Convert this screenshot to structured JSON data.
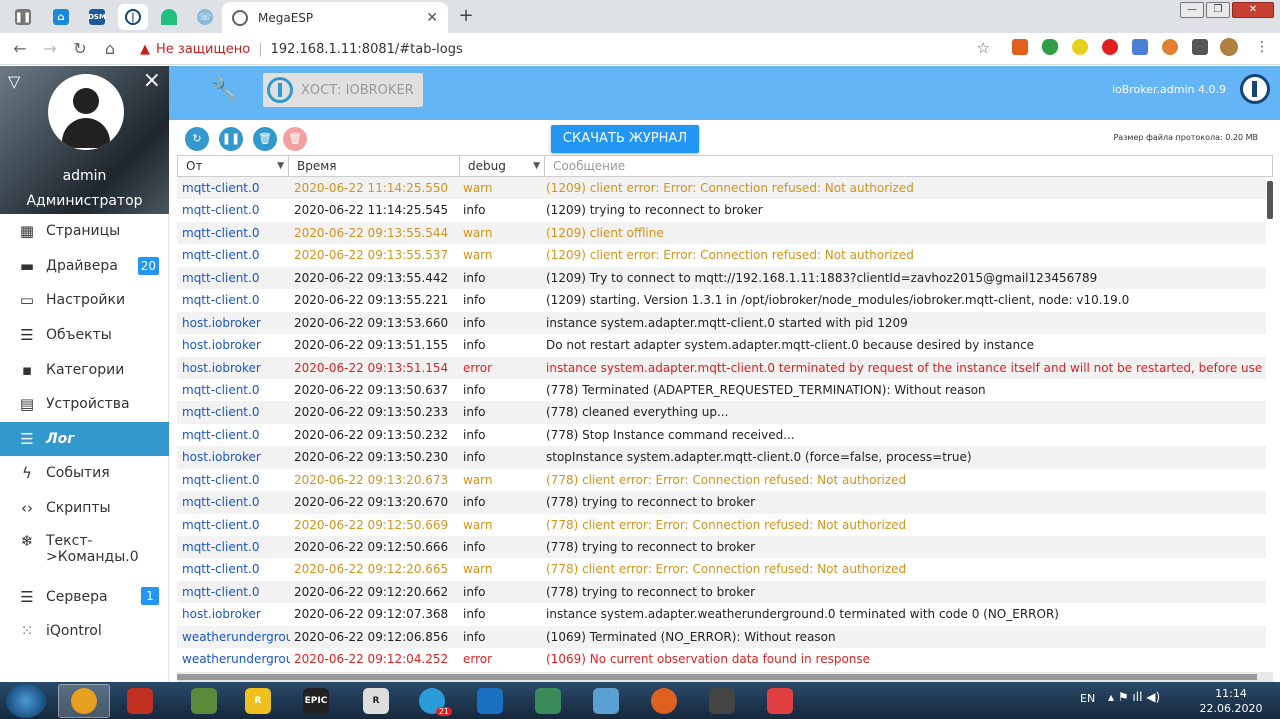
{
  "browser": {
    "tab_title": "MegaESP",
    "tab_close": "✕",
    "new_tab": "+",
    "not_secure": "Не защищено",
    "url": "192.168.1.11:8081/#tab-logs"
  },
  "sidebar": {
    "username": "admin",
    "role": "Администратор",
    "items": [
      {
        "label": "Страницы",
        "icon": "grid-icon"
      },
      {
        "label": "Драйвера",
        "icon": "store-icon",
        "badge": "20"
      },
      {
        "label": "Настройки",
        "icon": "settings-icon"
      },
      {
        "label": "Объекты",
        "icon": "list-icon"
      },
      {
        "label": "Категории",
        "icon": "categories-icon"
      },
      {
        "label": "Устройства",
        "icon": "devices-icon"
      },
      {
        "label": "Лог",
        "icon": "menu-icon",
        "active": true
      },
      {
        "label": "События",
        "icon": "bolt-icon"
      },
      {
        "label": "Скрипты",
        "icon": "code-icon"
      },
      {
        "label": "Текст-",
        "label2": ">Команды.0",
        "icon": "snowflake-icon"
      },
      {
        "label": "Сервера",
        "icon": "servers-icon",
        "badge": "1"
      },
      {
        "label": "iQontrol",
        "icon": "dots-icon"
      }
    ]
  },
  "header": {
    "host": "ХОСТ: IOBROKER",
    "version": "ioBroker.admin 4.0.9"
  },
  "log": {
    "download_label": "СКАЧАТЬ ЖУРНАЛ",
    "file_size": "Размер файла протокола: 0.20 MB",
    "columns": {
      "from": "От",
      "time": "Время",
      "severity": "debug",
      "message": "Сообщение"
    },
    "rows": [
      {
        "from": "mqtt-client.0",
        "time": "2020-06-22 11:14:25.550",
        "severity": "warn",
        "message": "(1209) client error: Error: Connection refused: Not authorized"
      },
      {
        "from": "mqtt-client.0",
        "time": "2020-06-22 11:14:25.545",
        "severity": "info",
        "message": "(1209) trying to reconnect to broker"
      },
      {
        "from": "mqtt-client.0",
        "time": "2020-06-22 09:13:55.544",
        "severity": "warn",
        "message": "(1209) client offline"
      },
      {
        "from": "mqtt-client.0",
        "time": "2020-06-22 09:13:55.537",
        "severity": "warn",
        "message": "(1209) client error: Error: Connection refused: Not authorized"
      },
      {
        "from": "mqtt-client.0",
        "time": "2020-06-22 09:13:55.442",
        "severity": "info",
        "message": "(1209) Try to connect to mqtt://192.168.1.11:1883?clientId=zavhoz2015@gmail123456789"
      },
      {
        "from": "mqtt-client.0",
        "time": "2020-06-22 09:13:55.221",
        "severity": "info",
        "message": "(1209) starting. Version 1.3.1 in /opt/iobroker/node_modules/iobroker.mqtt-client, node: v10.19.0"
      },
      {
        "from": "host.iobroker",
        "time": "2020-06-22 09:13:53.660",
        "severity": "info",
        "message": "instance system.adapter.mqtt-client.0 started with pid 1209"
      },
      {
        "from": "host.iobroker",
        "time": "2020-06-22 09:13:51.155",
        "severity": "info",
        "message": "Do not restart adapter system.adapter.mqtt-client.0 because desired by instance"
      },
      {
        "from": "host.iobroker",
        "time": "2020-06-22 09:13:51.154",
        "severity": "error",
        "message": "instance system.adapter.mqtt-client.0 terminated by request of the instance itself and will not be restarted, before user restarts it."
      },
      {
        "from": "mqtt-client.0",
        "time": "2020-06-22 09:13:50.637",
        "severity": "info",
        "message": "(778) Terminated (ADAPTER_REQUESTED_TERMINATION): Without reason"
      },
      {
        "from": "mqtt-client.0",
        "time": "2020-06-22 09:13:50.233",
        "severity": "info",
        "message": "(778) cleaned everything up..."
      },
      {
        "from": "mqtt-client.0",
        "time": "2020-06-22 09:13:50.232",
        "severity": "info",
        "message": "(778) Stop Instance command received..."
      },
      {
        "from": "host.iobroker",
        "time": "2020-06-22 09:13:50.230",
        "severity": "info",
        "message": "stopInstance system.adapter.mqtt-client.0 (force=false, process=true)"
      },
      {
        "from": "mqtt-client.0",
        "time": "2020-06-22 09:13:20.673",
        "severity": "warn",
        "message": "(778) client error: Error: Connection refused: Not authorized"
      },
      {
        "from": "mqtt-client.0",
        "time": "2020-06-22 09:13:20.670",
        "severity": "info",
        "message": "(778) trying to reconnect to broker"
      },
      {
        "from": "mqtt-client.0",
        "time": "2020-06-22 09:12:50.669",
        "severity": "warn",
        "message": "(778) client error: Error: Connection refused: Not authorized"
      },
      {
        "from": "mqtt-client.0",
        "time": "2020-06-22 09:12:50.666",
        "severity": "info",
        "message": "(778) trying to reconnect to broker"
      },
      {
        "from": "mqtt-client.0",
        "time": "2020-06-22 09:12:20.665",
        "severity": "warn",
        "message": "(778) client error: Error: Connection refused: Not authorized"
      },
      {
        "from": "mqtt-client.0",
        "time": "2020-06-22 09:12:20.662",
        "severity": "info",
        "message": "(778) trying to reconnect to broker"
      },
      {
        "from": "host.iobroker",
        "time": "2020-06-22 09:12:07.368",
        "severity": "info",
        "message": "instance system.adapter.weatherunderground.0 terminated with code 0 (NO_ERROR)"
      },
      {
        "from": "weatherunderground.0",
        "time": "2020-06-22 09:12:06.856",
        "severity": "info",
        "message": "(1069) Terminated (NO_ERROR): Without reason"
      },
      {
        "from": "weatherunderground.0",
        "time": "2020-06-22 09:12:04.252",
        "severity": "error",
        "message": "(1069) No current observation data found in response"
      }
    ]
  },
  "taskbar": {
    "apps": [
      {
        "icon": "chrome-icon",
        "color": "#e8a020",
        "active": true
      },
      {
        "icon": "ccleaner-icon",
        "color": "#c03020"
      },
      {
        "icon": "minecraft-icon",
        "color": "#5a8a3a"
      },
      {
        "icon": "rockstar-icon",
        "color": "#f0c020",
        "text": "R"
      },
      {
        "icon": "epic-games-icon",
        "color": "#222222",
        "text": "EPIC"
      },
      {
        "icon": "notepad-icon",
        "color": "#dddddd",
        "text": "R"
      },
      {
        "icon": "telegram-icon",
        "color": "#2a9ad8",
        "badge": "21"
      },
      {
        "icon": "network-app-icon",
        "color": "#1a70c0"
      },
      {
        "icon": "shield-app-icon",
        "color": "#3a8a5a"
      },
      {
        "icon": "mag-app-icon",
        "color": "#5aa0d0"
      },
      {
        "icon": "firefox-icon",
        "color": "#e06020"
      },
      {
        "icon": "settings-app-icon",
        "color": "#444444"
      },
      {
        "icon": "game-app-icon",
        "color": "#e04040"
      }
    ],
    "lang": "EN",
    "time": "11:14",
    "date": "22.06.2020"
  }
}
